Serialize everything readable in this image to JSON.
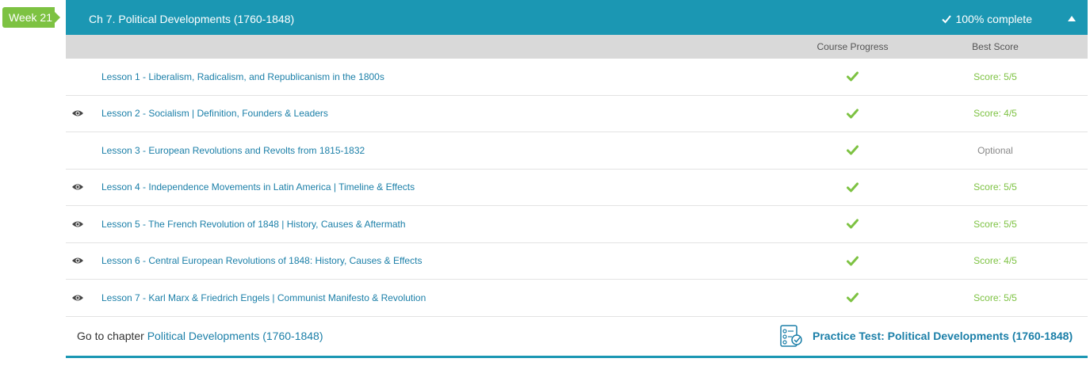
{
  "week_label": "Week 21",
  "chapter": {
    "title": "Ch 7. Political Developments (1760-1848)",
    "status": "100% complete"
  },
  "columns": {
    "progress": "Course Progress",
    "score": "Best Score"
  },
  "lessons": [
    {
      "title": "Lesson 1 - Liberalism, Radicalism, and Republicanism in the 1800s",
      "viewed": false,
      "score": "Score: 5/5",
      "optional": false
    },
    {
      "title": "Lesson 2 - Socialism | Definition, Founders & Leaders",
      "viewed": true,
      "score": "Score: 4/5",
      "optional": false
    },
    {
      "title": "Lesson 3 - European Revolutions and Revolts from 1815-1832",
      "viewed": false,
      "score": "Optional",
      "optional": true
    },
    {
      "title": "Lesson 4 - Independence Movements in Latin America | Timeline & Effects",
      "viewed": true,
      "score": "Score: 5/5",
      "optional": false
    },
    {
      "title": "Lesson 5 - The French Revolution of 1848 | History, Causes & Aftermath",
      "viewed": true,
      "score": "Score: 5/5",
      "optional": false
    },
    {
      "title": "Lesson 6 - Central European Revolutions of 1848: History, Causes & Effects",
      "viewed": true,
      "score": "Score: 4/5",
      "optional": false
    },
    {
      "title": "Lesson 7 - Karl Marx & Friedrich Engels | Communist Manifesto & Revolution",
      "viewed": true,
      "score": "Score: 5/5",
      "optional": false
    }
  ],
  "footer": {
    "goto_prefix": "Go to chapter",
    "goto_link": "Political Developments (1760-1848)",
    "practice_test": "Practice Test: Political Developments (1760-1848)"
  },
  "colors": {
    "header_bg": "#1b97b3",
    "week_badge": "#7dc242",
    "link": "#1b7fa8",
    "score_green": "#7dc242"
  },
  "icons": {
    "viewed": "eye-icon",
    "progress": "checkmark-icon",
    "collapse": "caret-up-icon",
    "practice_test": "checklist-icon"
  }
}
